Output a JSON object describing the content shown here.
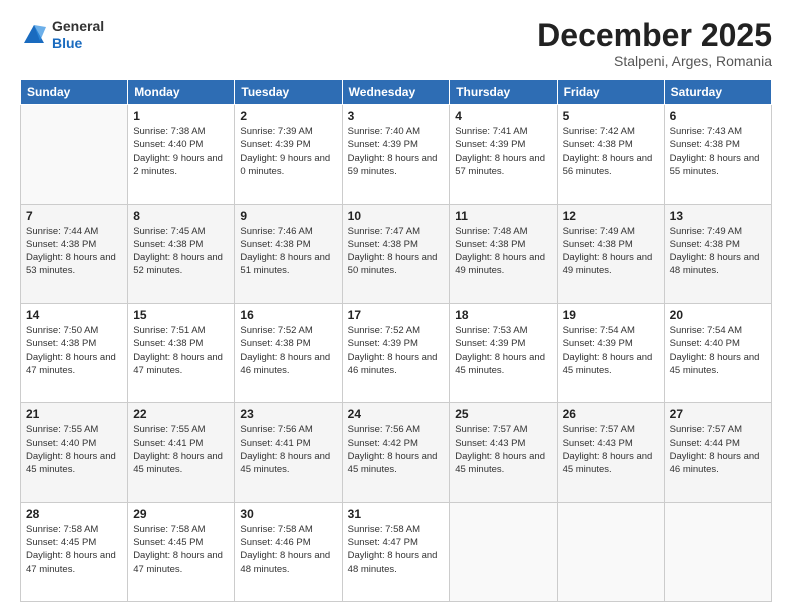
{
  "header": {
    "logo_general": "General",
    "logo_blue": "Blue",
    "month_title": "December 2025",
    "subtitle": "Stalpeni, Arges, Romania"
  },
  "days_of_week": [
    "Sunday",
    "Monday",
    "Tuesday",
    "Wednesday",
    "Thursday",
    "Friday",
    "Saturday"
  ],
  "weeks": [
    [
      {
        "day": "",
        "sunrise": "",
        "sunset": "",
        "daylight": ""
      },
      {
        "day": "1",
        "sunrise": "Sunrise: 7:38 AM",
        "sunset": "Sunset: 4:40 PM",
        "daylight": "Daylight: 9 hours and 2 minutes."
      },
      {
        "day": "2",
        "sunrise": "Sunrise: 7:39 AM",
        "sunset": "Sunset: 4:39 PM",
        "daylight": "Daylight: 9 hours and 0 minutes."
      },
      {
        "day": "3",
        "sunrise": "Sunrise: 7:40 AM",
        "sunset": "Sunset: 4:39 PM",
        "daylight": "Daylight: 8 hours and 59 minutes."
      },
      {
        "day": "4",
        "sunrise": "Sunrise: 7:41 AM",
        "sunset": "Sunset: 4:39 PM",
        "daylight": "Daylight: 8 hours and 57 minutes."
      },
      {
        "day": "5",
        "sunrise": "Sunrise: 7:42 AM",
        "sunset": "Sunset: 4:38 PM",
        "daylight": "Daylight: 8 hours and 56 minutes."
      },
      {
        "day": "6",
        "sunrise": "Sunrise: 7:43 AM",
        "sunset": "Sunset: 4:38 PM",
        "daylight": "Daylight: 8 hours and 55 minutes."
      }
    ],
    [
      {
        "day": "7",
        "sunrise": "Sunrise: 7:44 AM",
        "sunset": "Sunset: 4:38 PM",
        "daylight": "Daylight: 8 hours and 53 minutes."
      },
      {
        "day": "8",
        "sunrise": "Sunrise: 7:45 AM",
        "sunset": "Sunset: 4:38 PM",
        "daylight": "Daylight: 8 hours and 52 minutes."
      },
      {
        "day": "9",
        "sunrise": "Sunrise: 7:46 AM",
        "sunset": "Sunset: 4:38 PM",
        "daylight": "Daylight: 8 hours and 51 minutes."
      },
      {
        "day": "10",
        "sunrise": "Sunrise: 7:47 AM",
        "sunset": "Sunset: 4:38 PM",
        "daylight": "Daylight: 8 hours and 50 minutes."
      },
      {
        "day": "11",
        "sunrise": "Sunrise: 7:48 AM",
        "sunset": "Sunset: 4:38 PM",
        "daylight": "Daylight: 8 hours and 49 minutes."
      },
      {
        "day": "12",
        "sunrise": "Sunrise: 7:49 AM",
        "sunset": "Sunset: 4:38 PM",
        "daylight": "Daylight: 8 hours and 49 minutes."
      },
      {
        "day": "13",
        "sunrise": "Sunrise: 7:49 AM",
        "sunset": "Sunset: 4:38 PM",
        "daylight": "Daylight: 8 hours and 48 minutes."
      }
    ],
    [
      {
        "day": "14",
        "sunrise": "Sunrise: 7:50 AM",
        "sunset": "Sunset: 4:38 PM",
        "daylight": "Daylight: 8 hours and 47 minutes."
      },
      {
        "day": "15",
        "sunrise": "Sunrise: 7:51 AM",
        "sunset": "Sunset: 4:38 PM",
        "daylight": "Daylight: 8 hours and 47 minutes."
      },
      {
        "day": "16",
        "sunrise": "Sunrise: 7:52 AM",
        "sunset": "Sunset: 4:38 PM",
        "daylight": "Daylight: 8 hours and 46 minutes."
      },
      {
        "day": "17",
        "sunrise": "Sunrise: 7:52 AM",
        "sunset": "Sunset: 4:39 PM",
        "daylight": "Daylight: 8 hours and 46 minutes."
      },
      {
        "day": "18",
        "sunrise": "Sunrise: 7:53 AM",
        "sunset": "Sunset: 4:39 PM",
        "daylight": "Daylight: 8 hours and 45 minutes."
      },
      {
        "day": "19",
        "sunrise": "Sunrise: 7:54 AM",
        "sunset": "Sunset: 4:39 PM",
        "daylight": "Daylight: 8 hours and 45 minutes."
      },
      {
        "day": "20",
        "sunrise": "Sunrise: 7:54 AM",
        "sunset": "Sunset: 4:40 PM",
        "daylight": "Daylight: 8 hours and 45 minutes."
      }
    ],
    [
      {
        "day": "21",
        "sunrise": "Sunrise: 7:55 AM",
        "sunset": "Sunset: 4:40 PM",
        "daylight": "Daylight: 8 hours and 45 minutes."
      },
      {
        "day": "22",
        "sunrise": "Sunrise: 7:55 AM",
        "sunset": "Sunset: 4:41 PM",
        "daylight": "Daylight: 8 hours and 45 minutes."
      },
      {
        "day": "23",
        "sunrise": "Sunrise: 7:56 AM",
        "sunset": "Sunset: 4:41 PM",
        "daylight": "Daylight: 8 hours and 45 minutes."
      },
      {
        "day": "24",
        "sunrise": "Sunrise: 7:56 AM",
        "sunset": "Sunset: 4:42 PM",
        "daylight": "Daylight: 8 hours and 45 minutes."
      },
      {
        "day": "25",
        "sunrise": "Sunrise: 7:57 AM",
        "sunset": "Sunset: 4:43 PM",
        "daylight": "Daylight: 8 hours and 45 minutes."
      },
      {
        "day": "26",
        "sunrise": "Sunrise: 7:57 AM",
        "sunset": "Sunset: 4:43 PM",
        "daylight": "Daylight: 8 hours and 45 minutes."
      },
      {
        "day": "27",
        "sunrise": "Sunrise: 7:57 AM",
        "sunset": "Sunset: 4:44 PM",
        "daylight": "Daylight: 8 hours and 46 minutes."
      }
    ],
    [
      {
        "day": "28",
        "sunrise": "Sunrise: 7:58 AM",
        "sunset": "Sunset: 4:45 PM",
        "daylight": "Daylight: 8 hours and 47 minutes."
      },
      {
        "day": "29",
        "sunrise": "Sunrise: 7:58 AM",
        "sunset": "Sunset: 4:45 PM",
        "daylight": "Daylight: 8 hours and 47 minutes."
      },
      {
        "day": "30",
        "sunrise": "Sunrise: 7:58 AM",
        "sunset": "Sunset: 4:46 PM",
        "daylight": "Daylight: 8 hours and 48 minutes."
      },
      {
        "day": "31",
        "sunrise": "Sunrise: 7:58 AM",
        "sunset": "Sunset: 4:47 PM",
        "daylight": "Daylight: 8 hours and 48 minutes."
      },
      {
        "day": "",
        "sunrise": "",
        "sunset": "",
        "daylight": ""
      },
      {
        "day": "",
        "sunrise": "",
        "sunset": "",
        "daylight": ""
      },
      {
        "day": "",
        "sunrise": "",
        "sunset": "",
        "daylight": ""
      }
    ]
  ]
}
